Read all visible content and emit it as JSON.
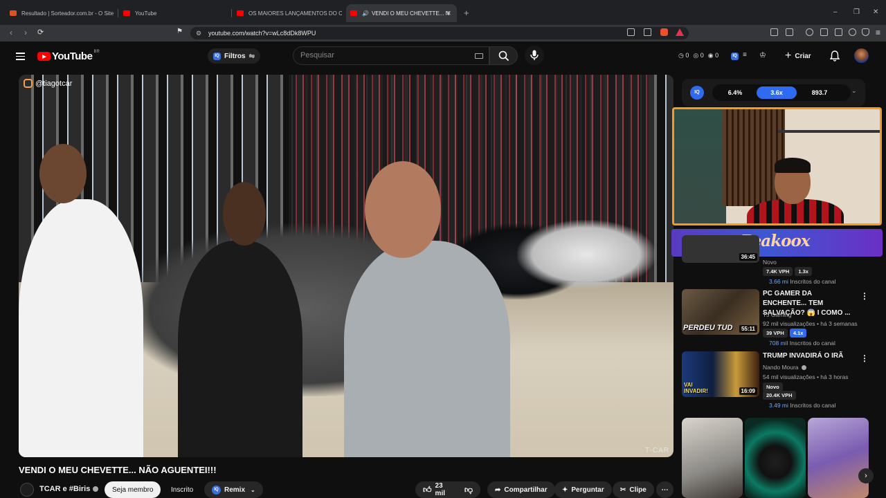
{
  "browser": {
    "tabs": [
      {
        "label": "Resultado | Sorteador.com.br - O Site"
      },
      {
        "label": "YouTube"
      },
      {
        "label": "OS MAIORES LANÇAMENTOS DO CI"
      },
      {
        "label": "VENDI O MEU CHEVETTE... N"
      }
    ],
    "new_tab": "+",
    "url": "youtube.com/watch?v=wLc8dDk8WPU",
    "window_controls": [
      "–",
      "❐",
      "✕"
    ]
  },
  "header": {
    "logo_word": "YouTube",
    "country_code": "BR",
    "filter_label": "Filtros",
    "search_placeholder": "Pesquisar",
    "stats": [
      "0",
      "0",
      "0"
    ],
    "create_label": "Criar"
  },
  "video": {
    "handle": "@tiagotcar",
    "watermark": "T-CAR",
    "title": "VENDI O MEU CHEVETTE... NÃO AGUENTEI!!!",
    "channel": "TCAR e #Biris",
    "join_label": "Seja membro",
    "subscribed_label": "Inscrito",
    "remix_label": "Remix",
    "likes": "23 mil",
    "share_label": "Compartilhar",
    "ask_label": "Perguntar",
    "clip_label": "Clipe",
    "more_label": "⋯"
  },
  "iq_panel": {
    "logo": "IQ",
    "values": [
      "6.4%",
      "3.6x",
      "893.7"
    ]
  },
  "banner_text": "Peakoox",
  "recommendations": [
    {
      "title": "",
      "meta1": "Novo",
      "badges": [
        "7.4K VPH",
        "1.3x"
      ],
      "subs_value": "3.66 mi",
      "subs_label": "Inscritos do canal",
      "duration": "36:45"
    },
    {
      "title": "PC GAMER DA ENCHENTE... TEM SALVAÇÃO? 😱 I COMO ...",
      "channel": "TJ Gaming",
      "meta1": "92 mil visualizações • há 3 semanas",
      "badges": [
        "39 VPH",
        "4.1x"
      ],
      "subs_value": "708 mil",
      "subs_label": "Inscritos do canal",
      "duration": "55:11",
      "thumb_text": "PERDEU TUD"
    },
    {
      "title": "TRUMP INVADIRÁ O IRÃ",
      "channel": "Nando Moura",
      "meta1": "54 mil visualizações • há 3 horas",
      "meta2": "Novo",
      "badges": [
        "20.4K VPH"
      ],
      "subs_value": "3.49 mi",
      "subs_label": "Inscritos do canal",
      "duration": "16:09",
      "thumb_text": "VAI INVADIR!"
    }
  ],
  "colors": {
    "accent": "#ff0000",
    "iq_blue": "#2f6bf0",
    "webcam_border": "#f59a23"
  }
}
